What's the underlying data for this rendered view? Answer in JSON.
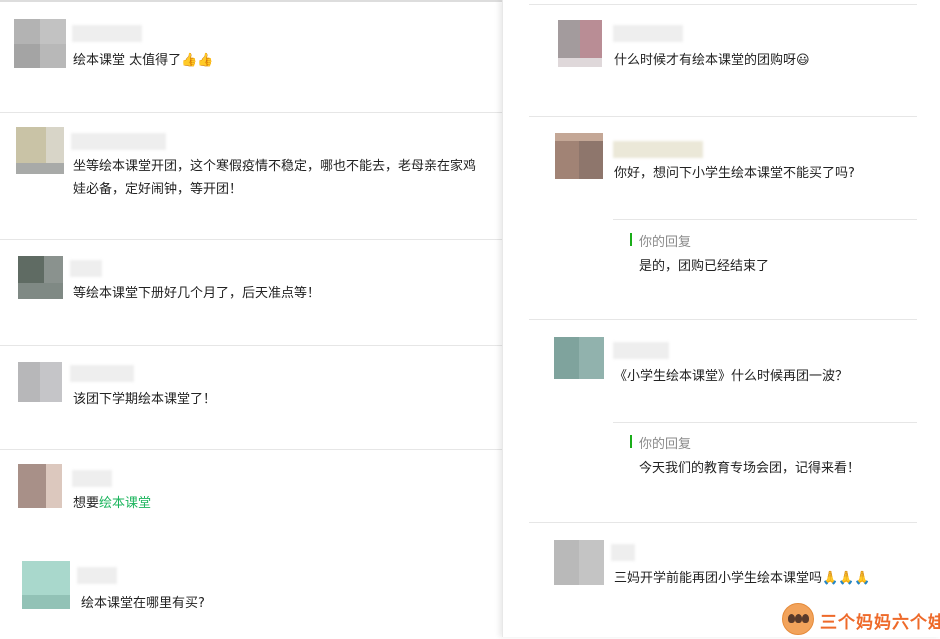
{
  "left_comments": [
    {
      "text": "绘本课堂 太值得了",
      "emoji": "👍👍"
    },
    {
      "text": "坐等绘本课堂开团，这个寒假疫情不稳定，哪也不能去，老母亲在家鸡娃必备，定好闹钟，等开团！"
    },
    {
      "text": "等绘本课堂下册好几个月了，后天准点等！"
    },
    {
      "text": "该团下学期绘本课堂了！"
    },
    {
      "text_prefix": "想要",
      "text_link": "绘本课堂"
    },
    {
      "text": "绘本课堂在哪里有买?"
    }
  ],
  "right_comments": [
    {
      "text": "什么时候才有绘本课堂的团购呀",
      "emoji": "😃"
    },
    {
      "text": "你好，想问下小学生绘本课堂不能买了吗?",
      "reply": {
        "label": "你的回复",
        "text": "是的，团购已经结束了"
      }
    },
    {
      "text": "《小学生绘本课堂》什么时候再团一波？",
      "reply": {
        "label": "你的回复",
        "text": "今天我们的教育专场会团，记得来看！"
      }
    },
    {
      "text": "三妈开学前能再团小学生绘本课堂吗",
      "emoji": "🙏🙏🙏"
    }
  ],
  "watermark": {
    "text": "三个妈妈六个娃"
  },
  "colors": {
    "reply_bar": "#1aad19",
    "link": "#1db55e",
    "watermark": "#ee6a2a"
  }
}
